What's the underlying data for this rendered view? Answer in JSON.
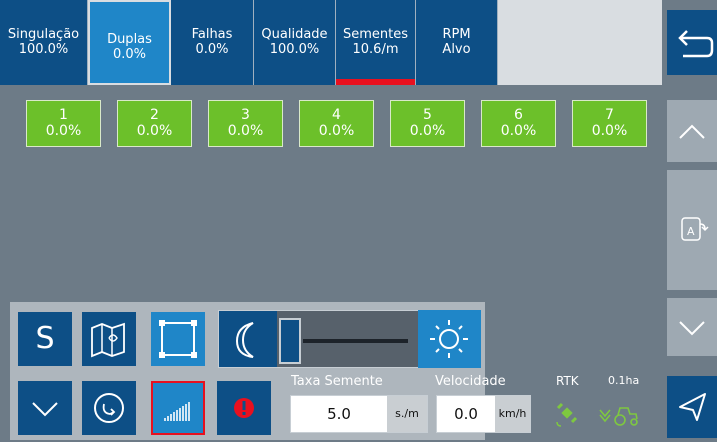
{
  "tabs": [
    {
      "label": "Singulação",
      "value": "100.0%"
    },
    {
      "label": "Duplas",
      "value": "0.0%"
    },
    {
      "label": "Falhas",
      "value": "0.0%"
    },
    {
      "label": "Qualidade",
      "value": "100.0%"
    },
    {
      "label": "Sementes",
      "value": "10.6/m"
    },
    {
      "label": "RPM",
      "value": "Alvo"
    }
  ],
  "rows": [
    {
      "num": "1",
      "value": "0.0%"
    },
    {
      "num": "2",
      "value": "0.0%"
    },
    {
      "num": "3",
      "value": "0.0%"
    },
    {
      "num": "4",
      "value": "0.0%"
    },
    {
      "num": "5",
      "value": "0.0%"
    },
    {
      "num": "6",
      "value": "0.0%"
    },
    {
      "num": "7",
      "value": "0.0%"
    }
  ],
  "buttons": {
    "s_label": "S"
  },
  "taxa": {
    "label": "Taxa Semente",
    "value": "5.0",
    "unit": "s./m"
  },
  "velocidade": {
    "label": "Velocidade",
    "value": "0.0",
    "unit": "km/h"
  },
  "status": {
    "rtk_label": "RTK",
    "area": "0.1ha"
  },
  "colors": {
    "primary_blue": "#0d4f86",
    "accent_blue": "#1f86c8",
    "row_green": "#6cc02a",
    "alert_red": "#e8101f"
  },
  "icons": {
    "back": "back-arrow-icon",
    "up": "chevron-up-icon",
    "down": "chevron-down-icon",
    "auto": "auto-mode-icon",
    "map": "map-icon",
    "frame": "frame-icon",
    "moon": "moon-icon",
    "sun": "sun-icon",
    "rotate": "rotate-icon",
    "signal": "signal-bars-icon",
    "alert": "alert-icon",
    "satellite": "satellite-icon",
    "tractor": "tractor-icon",
    "nav": "navigation-arrow-icon"
  }
}
